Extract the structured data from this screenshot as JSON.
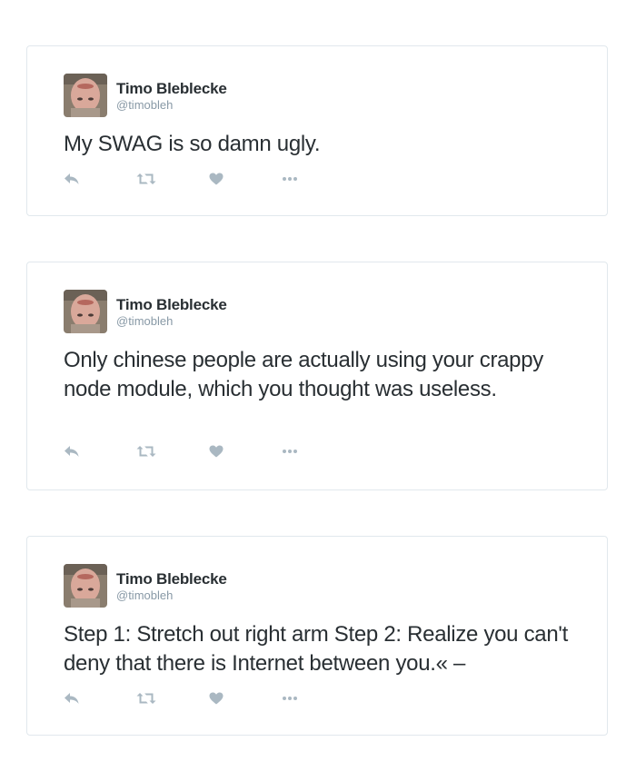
{
  "colors": {
    "card_border": "#e1e8ed",
    "text": "#292f33",
    "secondary": "#8899a6",
    "action_icon": "#aab8c2"
  },
  "tweets": [
    {
      "fullname": "Timo Bleblecke",
      "screen_name": "@timobleh",
      "text": "My SWAG is so damn ugly.",
      "actions": [
        "reply-icon",
        "retweet-icon",
        "like-heart-icon",
        "more-dots-icon"
      ]
    },
    {
      "fullname": "Timo Bleblecke",
      "screen_name": "@timobleh",
      "text": "Only chinese people are actually using your crappy node module, which you thought was useless.",
      "actions": [
        "reply-icon",
        "retweet-icon",
        "like-heart-icon",
        "more-dots-icon"
      ]
    },
    {
      "fullname": "Timo Bleblecke",
      "screen_name": "@timobleh",
      "text": "Step 1: Stretch out right arm Step 2: Realize you can't deny that there is Internet between you.« –",
      "actions": [
        "reply-icon",
        "retweet-icon",
        "like-heart-icon",
        "more-dots-icon"
      ]
    }
  ]
}
